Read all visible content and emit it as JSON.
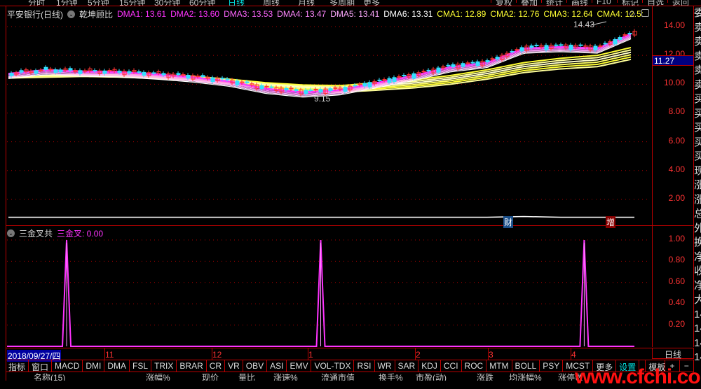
{
  "topbar": {
    "left": [
      "分时",
      "1分钟",
      "5分钟",
      "15分钟",
      "30分钟",
      "60分钟",
      "日线",
      "周线",
      "月线",
      "多周期",
      "更多"
    ],
    "active": "日线",
    "right": [
      "复权",
      "叠加",
      "统计",
      "画线",
      "F10",
      "标记",
      "自选",
      "返回"
    ]
  },
  "header": {
    "stock": "平安银行(日线)",
    "indicator": "乾坤顾比",
    "ma": [
      {
        "label": "DMA1: 13.61",
        "color": "#ff33ff"
      },
      {
        "label": "DMA2: 13.60",
        "color": "#ff33ff"
      },
      {
        "label": "DMA3: 13.53",
        "color": "#ff66ff"
      },
      {
        "label": "DMA4: 13.47",
        "color": "#ff88ff"
      },
      {
        "label": "DMA5: 13.41",
        "color": "#ffaaff"
      },
      {
        "label": "DMA6: 13.31",
        "color": "#ffffff"
      },
      {
        "label": "CMA1: 12.89",
        "color": "#ffff33"
      },
      {
        "label": "CMA2: 12.76",
        "color": "#ffff33"
      },
      {
        "label": "CMA3: 12.64",
        "color": "#ffff33"
      },
      {
        "label": "CMA4: 12.5:",
        "color": "#ffff33"
      }
    ]
  },
  "price_axis": {
    "ticks": [
      "14.00",
      "12.00",
      "10.00",
      "8.00",
      "6.00",
      "4.00",
      "2.00"
    ],
    "current": "11.27"
  },
  "annotations": {
    "high": "14.43",
    "low": "9.15",
    "flag_cai": "财",
    "flag_zeng": "增"
  },
  "lower": {
    "name": "三金叉共",
    "label": "三金叉: 0.00",
    "ticks": [
      "1.00",
      "0.80",
      "0.60",
      "0.40",
      "0.20"
    ]
  },
  "date_axis": {
    "cursor": "2018/09/27/四",
    "months": [
      "11",
      "12",
      "1",
      "2",
      "3",
      "4"
    ],
    "period": "日线"
  },
  "buttons": [
    "指标",
    "窗口",
    "MACD",
    "DMI",
    "DMA",
    "FSL",
    "TRIX",
    "BRAR",
    "CR",
    "VR",
    "OBV",
    "ASI",
    "EMV",
    "VOL-TDX",
    "RSI",
    "WR",
    "SAR",
    "KDJ",
    "CCI",
    "ROC",
    "MTM",
    "BOLL",
    "PSY",
    "MCST",
    "更多",
    "设置"
  ],
  "buttons_right": [
    "模板",
    "+",
    "−"
  ],
  "table_header": [
    "名称(15)",
    "涨幅%",
    "现价",
    "量比",
    "涨速%",
    "流通市值",
    "换手%",
    "市盈(动)",
    "涨跌",
    "均涨幅%",
    "涨停数"
  ],
  "right_strip": [
    "委",
    "卖",
    "卖",
    "卖",
    "卖",
    "卖",
    "买",
    "买",
    "买",
    "买",
    "买",
    "现",
    "涨",
    "涨",
    "总",
    "外",
    "换",
    "净",
    "收",
    "净",
    "大",
    "14",
    "14",
    "14",
    "14"
  ],
  "watermark": "www.cfchi.com",
  "colors": {
    "up": "#ff3333",
    "down": "#33e0ff",
    "border": "#bb0000",
    "dma": "#ff33ff",
    "cma": "#ffff33"
  },
  "chart_data": {
    "type": "line",
    "ylim": [
      0,
      15
    ],
    "x": [
      0,
      1,
      2,
      3,
      4,
      5,
      6,
      7,
      8,
      9,
      10,
      11,
      12,
      13,
      14,
      15,
      16,
      17
    ],
    "series": [
      {
        "name": "DMA",
        "values": [
          10.74,
          11.0,
          10.9,
          10.85,
          10.7,
          10.5,
          10.2,
          9.7,
          9.45,
          9.6,
          10.1,
          10.6,
          11.2,
          11.5,
          12.5,
          12.6,
          12.5,
          13.6
        ]
      },
      {
        "name": "CMA",
        "values": [
          10.5,
          10.6,
          10.7,
          10.7,
          10.65,
          10.55,
          10.35,
          10.1,
          9.95,
          9.9,
          10.1,
          10.3,
          10.6,
          11.0,
          11.5,
          11.8,
          12.0,
          12.6
        ]
      },
      {
        "name": "lower-line",
        "values": [
          1.0,
          1.0,
          1.0,
          1.0,
          1.0,
          1.0,
          1.0,
          1.0,
          1.0,
          1.0,
          1.0,
          1.0,
          1.0,
          1.0,
          1.05,
          1.0,
          1.0,
          1.0
        ]
      }
    ],
    "signal": {
      "name": "三金叉",
      "spikes_at": [
        0.095,
        0.5,
        0.92
      ],
      "ylim": [
        0,
        1.1
      ]
    }
  }
}
